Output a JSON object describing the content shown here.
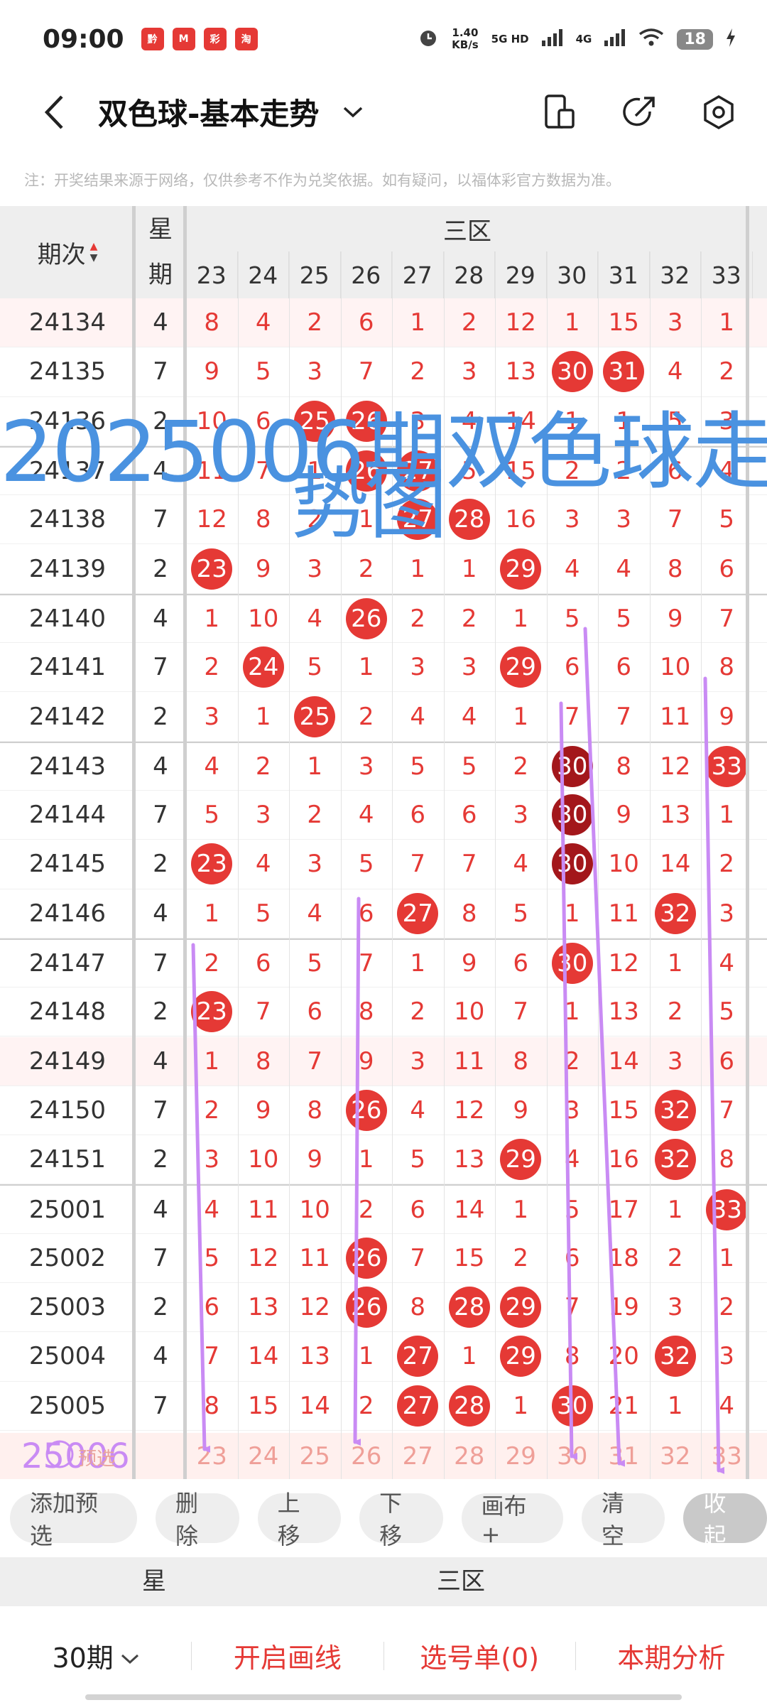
{
  "status_bar": {
    "time": "09:00",
    "app_badges": [
      "黔",
      "M",
      "彩",
      "淘"
    ],
    "net_speed_value": "1.40",
    "net_speed_unit": "KB/s",
    "signal_5g": "5G HD",
    "signal_4g": "4G",
    "battery": "18"
  },
  "header": {
    "title": "双色球-基本走势"
  },
  "disclaimer": "注：开奖结果来源于网络，仅供参考不作为兑奖依据。如有疑问，以福体彩官方数据为准。",
  "table": {
    "period_header": "期次",
    "week_header": "星期",
    "zone_header": "三区",
    "number_columns": [
      "23",
      "24",
      "25",
      "26",
      "27",
      "28",
      "29",
      "30",
      "31",
      "32",
      "33"
    ],
    "rows": [
      {
        "period": "24134",
        "week": "4",
        "cells": [
          "8",
          "4",
          "2",
          "6",
          "1",
          "2",
          "12",
          "1",
          "15",
          "3",
          "1"
        ],
        "hits": []
      },
      {
        "period": "24135",
        "week": "7",
        "cells": [
          "9",
          "5",
          "3",
          "7",
          "2",
          "3",
          "13",
          "30",
          "31",
          "4",
          "2"
        ],
        "hits": [
          7,
          8
        ]
      },
      {
        "period": "24136",
        "week": "2",
        "cells": [
          "10",
          "6",
          "25",
          "26",
          "3",
          "4",
          "14",
          "1",
          "1",
          "5",
          "3"
        ],
        "hits": [
          2,
          3
        ]
      },
      {
        "period": "24137",
        "week": "4",
        "cells": [
          "11",
          "7",
          "1",
          "26",
          "27",
          "5",
          "15",
          "2",
          "2",
          "6",
          "4"
        ],
        "hits": [
          3,
          4
        ]
      },
      {
        "period": "24138",
        "week": "7",
        "cells": [
          "12",
          "8",
          "2",
          "1",
          "27",
          "28",
          "16",
          "3",
          "3",
          "7",
          "5"
        ],
        "hits": [
          4,
          5
        ]
      },
      {
        "period": "24139",
        "week": "2",
        "cells": [
          "23",
          "9",
          "3",
          "2",
          "1",
          "1",
          "29",
          "4",
          "4",
          "8",
          "6"
        ],
        "hits": [
          0,
          6
        ]
      },
      {
        "period": "24140",
        "week": "4",
        "cells": [
          "1",
          "10",
          "4",
          "26",
          "2",
          "2",
          "1",
          "5",
          "5",
          "9",
          "7"
        ],
        "hits": [
          3
        ]
      },
      {
        "period": "24141",
        "week": "7",
        "cells": [
          "2",
          "24",
          "5",
          "1",
          "3",
          "3",
          "29",
          "6",
          "6",
          "10",
          "8"
        ],
        "hits": [
          1,
          6
        ]
      },
      {
        "period": "24142",
        "week": "2",
        "cells": [
          "3",
          "1",
          "25",
          "2",
          "4",
          "4",
          "1",
          "7",
          "7",
          "11",
          "9"
        ],
        "hits": [
          2
        ]
      },
      {
        "period": "24143",
        "week": "4",
        "cells": [
          "4",
          "2",
          "1",
          "3",
          "5",
          "5",
          "2",
          "30",
          "8",
          "12",
          "33"
        ],
        "hits": [
          7,
          10
        ],
        "dark": [
          7
        ]
      },
      {
        "period": "24144",
        "week": "7",
        "cells": [
          "5",
          "3",
          "2",
          "4",
          "6",
          "6",
          "3",
          "30",
          "9",
          "13",
          "1"
        ],
        "hits": [
          7
        ],
        "dark": [
          7
        ]
      },
      {
        "period": "24145",
        "week": "2",
        "cells": [
          "23",
          "4",
          "3",
          "5",
          "7",
          "7",
          "4",
          "30",
          "10",
          "14",
          "2"
        ],
        "hits": [
          0,
          7
        ],
        "dark": [
          7
        ]
      },
      {
        "period": "24146",
        "week": "4",
        "cells": [
          "1",
          "5",
          "4",
          "6",
          "27",
          "8",
          "5",
          "1",
          "11",
          "32",
          "3"
        ],
        "hits": [
          4,
          9
        ]
      },
      {
        "period": "24147",
        "week": "7",
        "cells": [
          "2",
          "6",
          "5",
          "7",
          "1",
          "9",
          "6",
          "30",
          "12",
          "1",
          "4"
        ],
        "hits": [
          7
        ]
      },
      {
        "period": "24148",
        "week": "2",
        "cells": [
          "23",
          "7",
          "6",
          "8",
          "2",
          "10",
          "7",
          "1",
          "13",
          "2",
          "5"
        ],
        "hits": [
          0
        ]
      },
      {
        "period": "24149",
        "week": "4",
        "cells": [
          "1",
          "8",
          "7",
          "9",
          "3",
          "11",
          "8",
          "2",
          "14",
          "3",
          "6"
        ],
        "hits": []
      },
      {
        "period": "24150",
        "week": "7",
        "cells": [
          "2",
          "9",
          "8",
          "26",
          "4",
          "12",
          "9",
          "3",
          "15",
          "32",
          "7"
        ],
        "hits": [
          3,
          9
        ]
      },
      {
        "period": "24151",
        "week": "2",
        "cells": [
          "3",
          "10",
          "9",
          "1",
          "5",
          "13",
          "29",
          "4",
          "16",
          "32",
          "8"
        ],
        "hits": [
          6,
          9
        ]
      },
      {
        "period": "25001",
        "week": "4",
        "cells": [
          "4",
          "11",
          "10",
          "2",
          "6",
          "14",
          "1",
          "5",
          "17",
          "1",
          "33"
        ],
        "hits": [
          10
        ]
      },
      {
        "period": "25002",
        "week": "7",
        "cells": [
          "5",
          "12",
          "11",
          "26",
          "7",
          "15",
          "2",
          "6",
          "18",
          "2",
          "1"
        ],
        "hits": [
          3
        ]
      },
      {
        "period": "25003",
        "week": "2",
        "cells": [
          "6",
          "13",
          "12",
          "26",
          "8",
          "28",
          "29",
          "7",
          "19",
          "3",
          "2"
        ],
        "hits": [
          3,
          5,
          6
        ]
      },
      {
        "period": "25004",
        "week": "4",
        "cells": [
          "7",
          "14",
          "13",
          "1",
          "27",
          "1",
          "29",
          "8",
          "20",
          "32",
          "3"
        ],
        "hits": [
          4,
          6,
          9
        ]
      },
      {
        "period": "25005",
        "week": "7",
        "cells": [
          "8",
          "15",
          "14",
          "2",
          "27",
          "28",
          "1",
          "30",
          "21",
          "1",
          "4"
        ],
        "hits": [
          4,
          5,
          7
        ]
      }
    ],
    "predict_period": "25006",
    "predict_label": "预选",
    "predict_cells": [
      "23",
      "24",
      "25",
      "26",
      "27",
      "28",
      "29",
      "30",
      "31",
      "32",
      "33"
    ]
  },
  "watermark": {
    "line1": "2025006期双色球走",
    "line2": "势图"
  },
  "actions": [
    "添加预选",
    "删除",
    "上移",
    "下移",
    "画布+",
    "清空",
    "收起"
  ],
  "lower_header": {
    "week": "星",
    "zone": "三区"
  },
  "bottom_bar": {
    "periods": "30期",
    "draw_line": "开启画线",
    "pick_list": "选号单(0)",
    "analysis": "本期分析"
  },
  "colors": {
    "accent": "#e53935",
    "dark_ball": "#a3171b",
    "watermark": "#4a92e0",
    "arrow": "#c98bf4"
  },
  "icons": [
    "back-icon",
    "chevron-down-icon",
    "device-icon",
    "share-icon",
    "settings-icon"
  ]
}
